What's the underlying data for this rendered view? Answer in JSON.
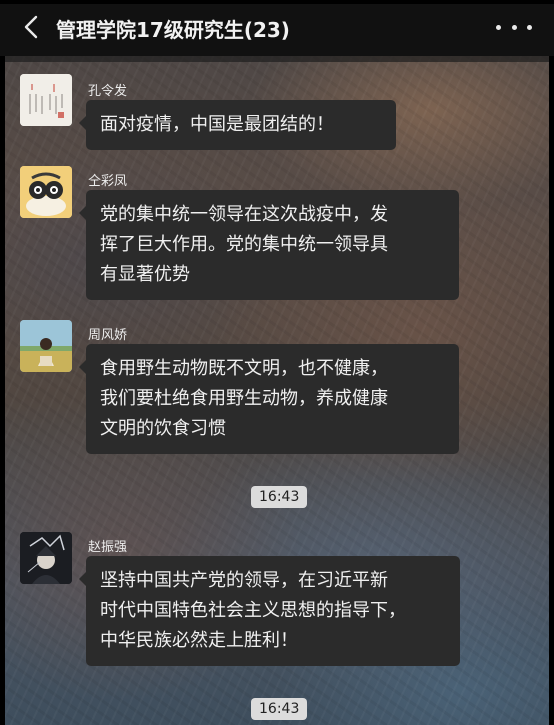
{
  "header": {
    "title": "管理学院17级研究生(23)",
    "back_icon": "chevron-left-icon",
    "more_icon": "ellipsis-icon"
  },
  "messages": [
    {
      "sender": "孔令发",
      "avatar": "calligraphy-avatar",
      "lines": [
        "面对疫情，中国是最团结的！"
      ]
    },
    {
      "sender": "仝彩凤",
      "avatar": "cartoon-avatar",
      "lines": [
        "党的集中统一领导在这次战疫中，发",
        "挥了巨大作用。党的集中统一领导具",
        "有显著优势"
      ]
    },
    {
      "sender": "周风娇",
      "avatar": "girl-field-avatar",
      "lines": [
        "食用野生动物既不文明，也不健康，",
        "我们要杜绝食用野生动物，养成健康",
        "文明的饮食习惯"
      ]
    },
    {
      "sender": "赵振强",
      "avatar": "anime-avatar",
      "lines": [
        "坚持中国共产党的领导，在习近平新",
        "时代中国特色社会主义思想的指导下，",
        "中华民族必然走上胜利！"
      ]
    }
  ],
  "timestamps": [
    "16:43",
    "16:43"
  ],
  "colors": {
    "title_bar": "#111111",
    "bubble": "#2b2b2b",
    "timestamp_bg": "#dcdcdc"
  }
}
